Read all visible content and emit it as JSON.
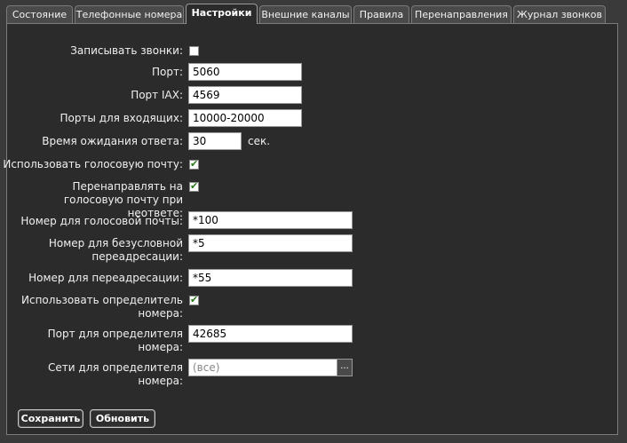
{
  "tabs": [
    {
      "label": "Состояние"
    },
    {
      "label": "Телефонные номера"
    },
    {
      "label": "Настройки"
    },
    {
      "label": "Внешние каналы"
    },
    {
      "label": "Правила"
    },
    {
      "label": "Перенаправления"
    },
    {
      "label": "Журнал звонков"
    }
  ],
  "active_tab": "Настройки",
  "form": {
    "record_calls": {
      "label": "Записывать звонки:",
      "checked": false
    },
    "port": {
      "label": "Порт:",
      "value": "5060"
    },
    "iax_port": {
      "label": "Порт IAX:",
      "value": "4569"
    },
    "incoming_ports": {
      "label": "Порты для входящих:",
      "value": "10000-20000"
    },
    "answer_timeout": {
      "label": "Время ожидания ответа:",
      "value": "30",
      "unit": "сек."
    },
    "use_voicemail": {
      "label": "Использовать голосовую почту:",
      "checked": true
    },
    "redirect_voicemail": {
      "label": "Перенаправлять на голосовую почту при неответе:",
      "checked": true
    },
    "voicemail_number": {
      "label": "Номер для голосовой почты:",
      "value": "*100"
    },
    "unconditional_forward_number": {
      "label": "Номер для безусловной переадресации:",
      "value": "*5"
    },
    "forward_number": {
      "label": "Номер для переадресации:",
      "value": "*55"
    },
    "use_caller_id": {
      "label": "Использовать определитель номера:",
      "checked": true
    },
    "caller_id_port": {
      "label": "Порт для определителя номера:",
      "value": "42685"
    },
    "caller_id_networks": {
      "label": "Сети для определителя номера:",
      "placeholder": "(все)",
      "browse_label": "..."
    }
  },
  "buttons": {
    "save": "Сохранить",
    "refresh": "Обновить"
  },
  "colors": {
    "background": "#3a3a3a",
    "panel": "#2b2b2b",
    "checkmark": "#2a7a1a"
  }
}
